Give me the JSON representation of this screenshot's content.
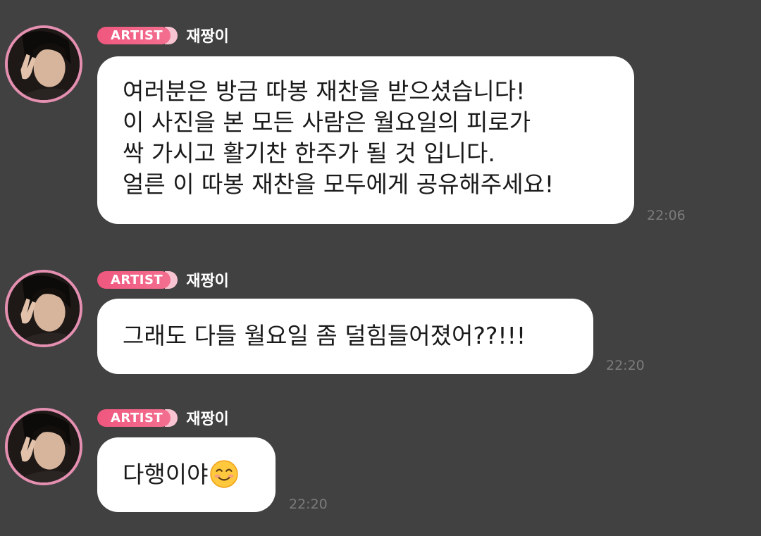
{
  "messages": [
    {
      "badge": "ARTIST",
      "sender": "재짱이",
      "lines": [
        "여러분은 방금 따봉 재찬을 받으셨습니다!",
        "이 사진을 본 모든 사람은 월요일의 피로가",
        "싹 가시고 활기찬 한주가 될 것 입니다.",
        "얼른 이 따봉 재찬을 모두에게 공유해주세요!"
      ],
      "time": "22:06"
    },
    {
      "badge": "ARTIST",
      "sender": "재짱이",
      "text": "그래도 다들 월요일 좀 덜힘들어졌어??!!!",
      "time": "22:20"
    },
    {
      "badge": "ARTIST",
      "sender": "재짱이",
      "text": "다행이야",
      "emoji": "smiling-face-emoji",
      "time": "22:20"
    }
  ],
  "colors": {
    "background": "#414141",
    "bubble": "#ffffff",
    "badge": "#f0577f",
    "avatar_ring": "#e58fb1",
    "timestamp": "#7c7c7c"
  }
}
